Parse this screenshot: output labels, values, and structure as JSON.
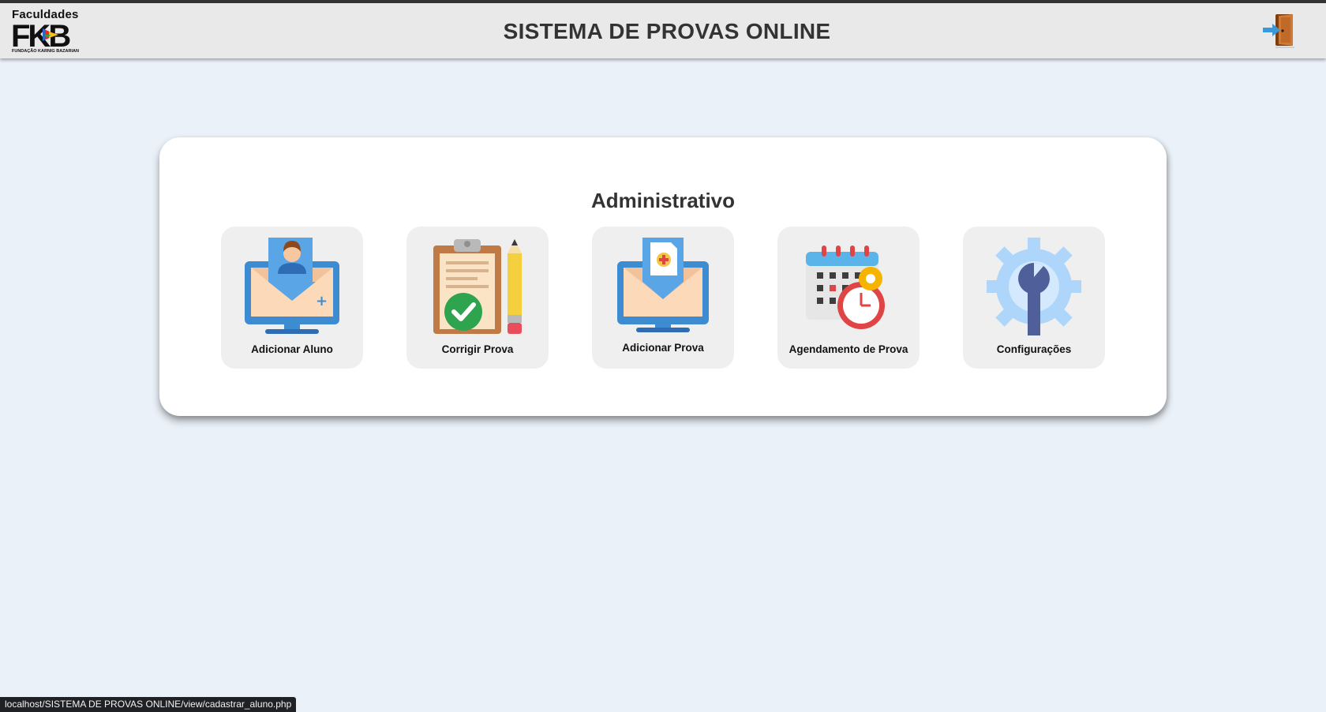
{
  "header": {
    "logo": {
      "brand_top": "Faculdades",
      "brand_mark": "FKB",
      "brand_sub": "FUNDAÇÃO KARNIG BAZARIAN"
    },
    "title": "SISTEMA DE PROVAS ONLINE",
    "logout_icon": "door-exit-icon"
  },
  "panel": {
    "title": "Administrativo",
    "cards": [
      {
        "label": "Adicionar Aluno",
        "icon": "add-student-monitor-icon"
      },
      {
        "label": "Corrigir Prova",
        "icon": "clipboard-check-icon"
      },
      {
        "label": "Adicionar Prova",
        "icon": "add-exam-monitor-icon"
      },
      {
        "label": "Agendamento de Prova",
        "icon": "calendar-clock-icon"
      },
      {
        "label": "Configurações",
        "icon": "gear-wrench-icon"
      }
    ]
  },
  "statusbar": {
    "url": "localhost/SISTEMA DE PROVAS ONLINE/view/cadastrar_aluno.php"
  },
  "colors": {
    "background": "#ebf1f9",
    "header": "#e9e9e9",
    "card": "#efefef",
    "monitor_blue": "#3d8bd0",
    "check_green": "#34a853"
  }
}
